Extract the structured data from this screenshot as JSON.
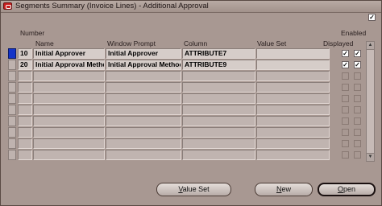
{
  "window": {
    "title": "Segments Summary (Invoice Lines) - Additional Approval"
  },
  "header": {
    "number_label": "Number",
    "name_label": "Name",
    "window_prompt_label": "Window Prompt",
    "column_label": "Column",
    "value_set_label": "Value Set",
    "enabled_label": "Enabled",
    "displayed_label": "Displayed"
  },
  "rows": [
    {
      "number": "10",
      "name": "Initial Approver",
      "prompt": "Initial Approver",
      "column": "ATTRIBUTE7",
      "value_set": "",
      "displayed": true,
      "enabled": true
    },
    {
      "number": "20",
      "name": "Initial Approval Metho",
      "prompt": "Initial Approval Method",
      "column": "ATTRIBUTE9",
      "value_set": "",
      "displayed": true,
      "enabled": true
    }
  ],
  "buttons": {
    "value_set": "Value Set",
    "new": "New",
    "open": "Open"
  }
}
